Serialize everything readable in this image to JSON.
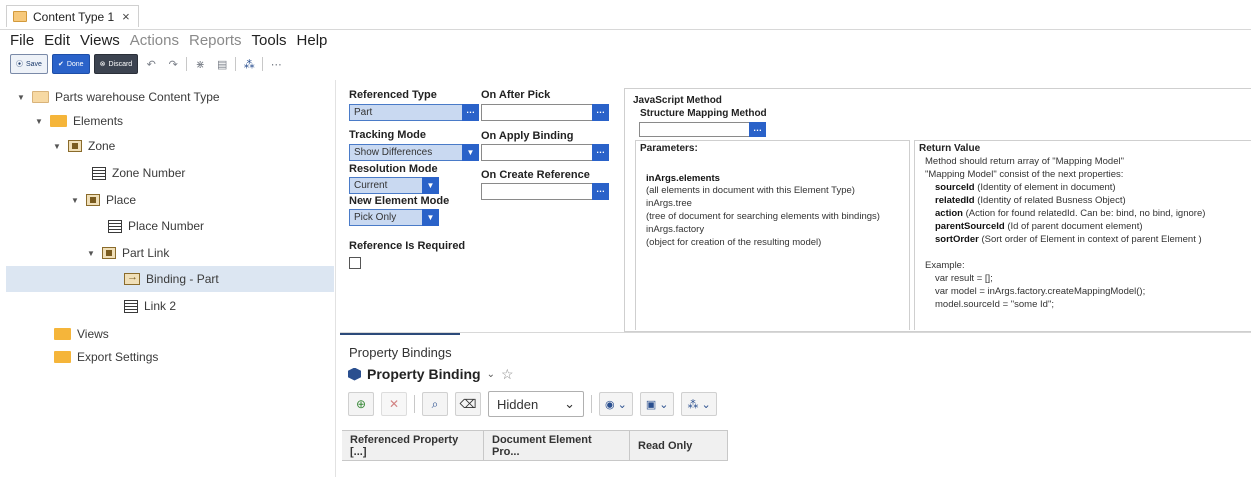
{
  "tab": {
    "title": "Content Type 1",
    "close": "×"
  },
  "menu": {
    "file": "File",
    "edit": "Edit",
    "views": "Views",
    "actions": "Actions",
    "reports": "Reports",
    "tools": "Tools",
    "help": "Help"
  },
  "toolbar": {
    "save": "Save",
    "done": "Done",
    "discard": "Discard"
  },
  "tree": {
    "root": "Parts warehouse Content Type",
    "elements": "Elements",
    "zone": "Zone",
    "zone_number": "Zone Number",
    "place": "Place",
    "place_number": "Place Number",
    "part_link": "Part Link",
    "binding_part": "Binding - Part",
    "link2": "Link 2",
    "views": "Views",
    "export_settings": "Export Settings"
  },
  "form": {
    "referenced_type_label": "Referenced Type",
    "referenced_type_value": "Part",
    "tracking_mode_label": "Tracking Mode",
    "tracking_mode_value": "Show Differences",
    "resolution_mode_label": "Resolution Mode",
    "resolution_mode_value": "Current",
    "new_element_mode_label": "New Element Mode",
    "new_element_mode_value": "Pick Only",
    "reference_required_label": "Reference Is Required",
    "on_after_pick_label": "On After Pick",
    "on_apply_binding_label": "On Apply Binding",
    "on_create_reference_label": "On Create Reference"
  },
  "js": {
    "title": "JavaScript Method",
    "structure_label": "Structure Mapping Method",
    "params_title": "Parameters:",
    "params": [
      "inArgs.elements",
      "(all elements in document with this Element Type)",
      "inArgs.tree",
      "(tree of document for searching elements with bindings)",
      "inArgs.factory",
      "(object for creation of the resulting model)"
    ],
    "return_title": "Return Value",
    "return_lines": [
      "Method should return array of \"Mapping Model\"",
      "\"Mapping Model\" consist of the next properties:"
    ],
    "props": [
      {
        "name": "sourceId",
        "desc": " (Identity of element in document)"
      },
      {
        "name": "relatedId",
        "desc": " (Identity of related Busness Object)"
      },
      {
        "name": "action",
        "desc": " (Action for found relatedId. Can be: bind, no bind, ignore)"
      },
      {
        "name": "parentSourceId",
        "desc": " (Id of parent document element)"
      },
      {
        "name": "sortOrder",
        "desc": " (Sort order of Element in context of parent Element )"
      }
    ],
    "example_title": "Example:",
    "example_lines": [
      "var result = [];",
      "var model = inArgs.factory.createMappingModel();",
      "model.sourceId = \"some Id\";"
    ]
  },
  "bottom": {
    "panel_tab": "Property Bindings",
    "title": "Property Binding",
    "chevron": "⌄",
    "star": "☆",
    "hidden": "Hidden",
    "columns": [
      "Referenced Property [...]",
      "Document Element Pro...",
      "Read Only"
    ]
  },
  "colors": {
    "accent": "#2a62c9",
    "select_bg": "#c9d9f1",
    "selected_row": "#dce6f2"
  }
}
